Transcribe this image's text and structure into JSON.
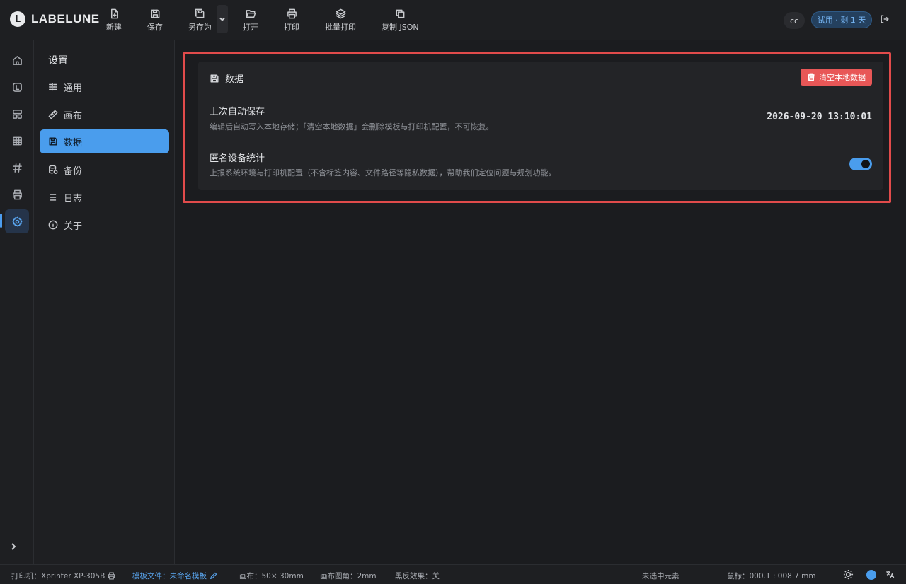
{
  "app": {
    "name": "LABELUNE"
  },
  "toolbar": {
    "new_label": "新建",
    "save_label": "保存",
    "save_as_label": "另存为",
    "open_label": "打开",
    "print_label": "打印",
    "batch_print_label": "批量打印",
    "copy_json_label": "复制 JSON"
  },
  "header": {
    "user_initials": "cc",
    "trial_badge": "试用 · 剩 1 天"
  },
  "settings": {
    "title": "设置",
    "items": [
      {
        "label": "通用",
        "icon": "sliders-icon"
      },
      {
        "label": "画布",
        "icon": "ruler-icon"
      },
      {
        "label": "数据",
        "icon": "save-icon",
        "active": true
      },
      {
        "label": "备份",
        "icon": "database-icon"
      },
      {
        "label": "日志",
        "icon": "list-icon"
      },
      {
        "label": "关于",
        "icon": "info-circle-icon"
      }
    ]
  },
  "data_panel": {
    "title": "数据",
    "clear_button": "清空本地数据",
    "autosave": {
      "title": "上次自动保存",
      "description": "编辑后自动写入本地存储；「清空本地数据」会删除模板与打印机配置，不可恢复。",
      "value": "2026-09-20 13:10:01"
    },
    "telemetry": {
      "title": "匿名设备统计",
      "description": "上报系统环境与打印机配置（不含标签内容、文件路径等隐私数据），帮助我们定位问题与规划功能。",
      "enabled": true
    }
  },
  "statusbar": {
    "printer": "打印机：Xprinter XP-305B",
    "template_label": "模板文件：",
    "template_name": "未命名模板",
    "canvas": "画布：50× 30mm",
    "canvas_radius": "画布圆角：2mm",
    "invert": "黑反效果：关",
    "selection": "未选中元素",
    "cursor": "鼠标：000.1 : 008.7 mm"
  },
  "colors": {
    "accent": "#4a9ded",
    "danger": "#e85757",
    "highlight_frame": "#e14b4b",
    "background": "#1b1c1f"
  }
}
